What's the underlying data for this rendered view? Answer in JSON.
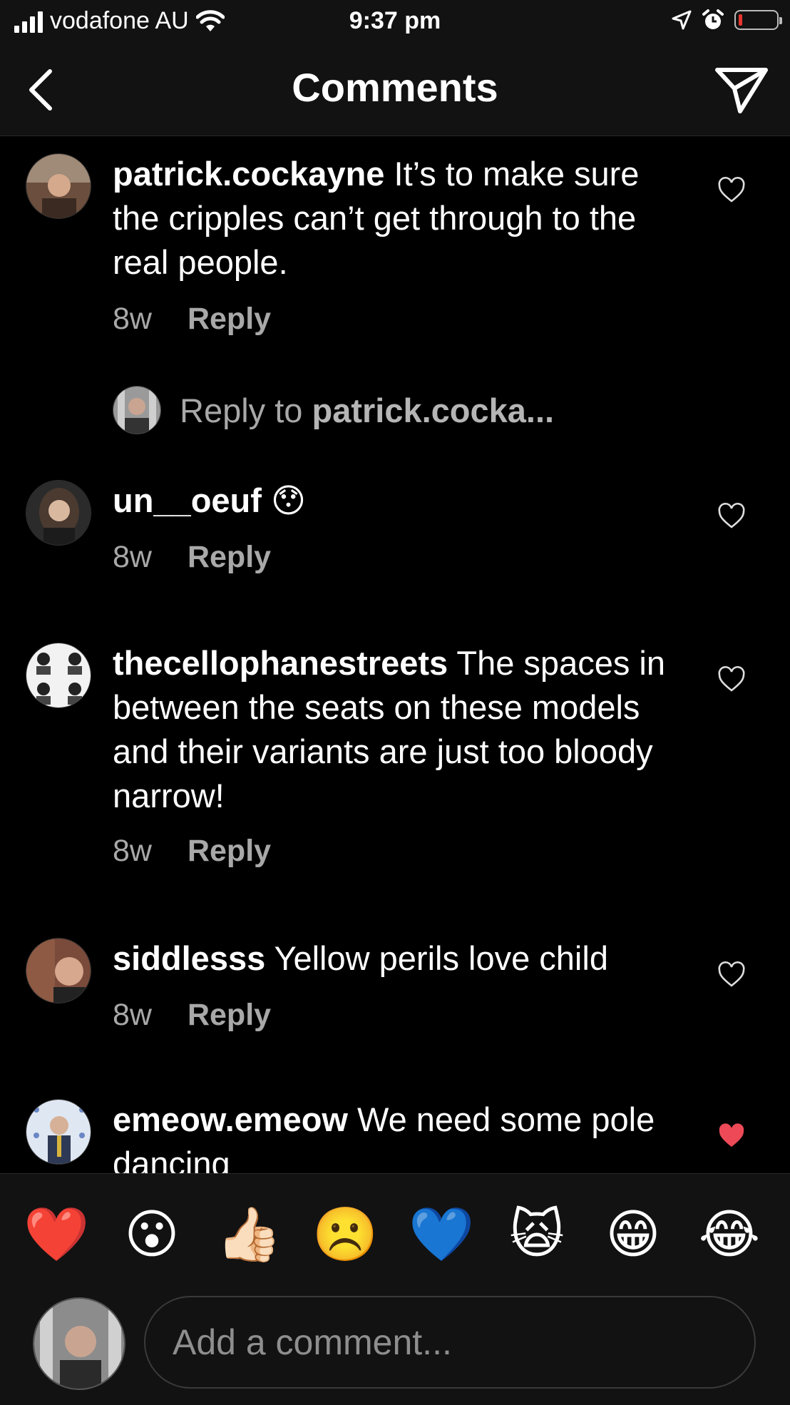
{
  "status_bar": {
    "carrier": "vodafone AU",
    "time": "9:37 pm"
  },
  "header": {
    "title": "Comments"
  },
  "comments": [
    {
      "username": "patrick.cockayne",
      "text": " It’s to make sure the cripples can’t get through to the real people.",
      "age": "8w",
      "reply_label": "Reply",
      "liked": false,
      "reply_prompt": {
        "prefix": "Reply to ",
        "target": "patrick.cocka..."
      }
    },
    {
      "username": "un__oeuf",
      "text": " 😯",
      "age": "8w",
      "reply_label": "Reply",
      "liked": false
    },
    {
      "username": "thecellophanestreets",
      "text": " The spaces in between the seats on these models and their variants are just too bloody narrow!",
      "age": "8w",
      "reply_label": "Reply",
      "liked": false
    },
    {
      "username": "siddlesss",
      "text": " Yellow perils love child",
      "age": "8w",
      "reply_label": "Reply",
      "liked": false
    },
    {
      "username": "emeow.emeow",
      "text": " We need some pole dancing",
      "liked": true
    }
  ],
  "quick_reactions": [
    "❤️",
    "😮",
    "👍🏻",
    "☹️",
    "💙",
    "🙀",
    "😁",
    "😂"
  ],
  "composer": {
    "placeholder": "Add a comment..."
  },
  "colors": {
    "background": "#000000",
    "bar": "#121212",
    "secondary_text": "#a8a8a8",
    "liked_heart": "#ed4956"
  }
}
